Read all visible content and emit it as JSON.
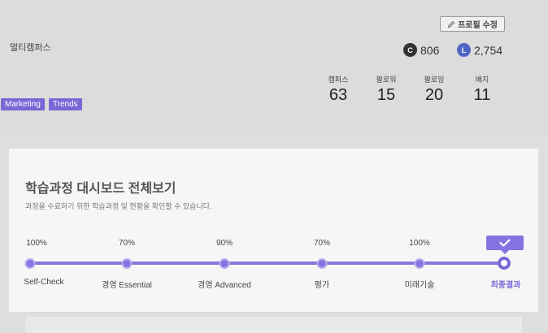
{
  "profile": {
    "name": "멀티캠퍼스",
    "edit_label": "프로필 수정",
    "points": [
      {
        "icon": "C",
        "value": "806"
      },
      {
        "icon": "L",
        "value": "2,754"
      }
    ],
    "stats": [
      {
        "label": "캠퍼스",
        "value": "63"
      },
      {
        "label": "팔로워",
        "value": "15"
      },
      {
        "label": "팔로잉",
        "value": "20"
      },
      {
        "label": "배지",
        "value": "11"
      }
    ],
    "tags": [
      "Marketing",
      "Trends"
    ]
  },
  "dashboard": {
    "title": "학습과정 대시보드 전체보기",
    "description": "과정을 수료하기 위한 학습과정 및 현황을 확인할 수 있습니다.",
    "steps": [
      {
        "percent": "100%",
        "label": "Self-Check"
      },
      {
        "percent": "70%",
        "label": "경영 Essential"
      },
      {
        "percent": "90%",
        "label": "경영 Advanced"
      },
      {
        "percent": "70%",
        "label": "평가"
      },
      {
        "percent": "100%",
        "label": "미래기술"
      },
      {
        "percent": "",
        "label": "최종결과"
      }
    ]
  }
}
